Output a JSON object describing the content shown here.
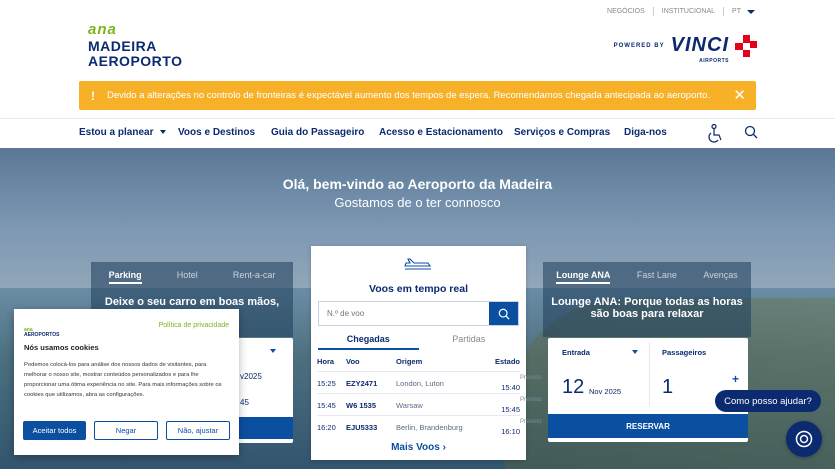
{
  "logo": {
    "ana": "ana",
    "line1": "MADEIRA",
    "line2": "AEROPORTO"
  },
  "toplinks": {
    "negocios": "NEGÓCIOS",
    "institucional": "INSTITUCIONAL",
    "lang": "PT"
  },
  "vinci": {
    "powered": "POWERED BY",
    "name": "VINCI",
    "airports": "AIRPORTS"
  },
  "alert": {
    "icon": "!",
    "text": "Devido a alterações no controlo de fronteiras é expectável aumento dos tempos de espera. Recomendamos chegada antecipada ao aeroporto.",
    "close": "✕"
  },
  "nav": {
    "items": [
      "Estou a planear",
      "Voos e Destinos",
      "Guia do Passageiro",
      "Acesso e Estacionamento",
      "Serviços e Compras",
      "Diga-nos"
    ]
  },
  "welcome": {
    "title": "Olá, bem-vindo ao Aeroporto da Madeira",
    "subtitle": "Gostamos de o ter connosco"
  },
  "parking": {
    "tabs": [
      "Parking",
      "Hotel",
      "Rent-a-car"
    ],
    "message": "Deixe o seu carro em boas mãos,",
    "date1": "v2025",
    "date2": "45"
  },
  "flights": {
    "title": "Voos em tempo real",
    "placeholder": "N.º de voo",
    "tabs": [
      "Chegadas",
      "Partidas"
    ],
    "headers": [
      "Hora",
      "Voo",
      "Origem",
      "Estado"
    ],
    "rows": [
      {
        "time": "15:25",
        "flight": "EZY2471",
        "origin": "London, Luton",
        "status": "Previsto",
        "eta": "15:40"
      },
      {
        "time": "15:45",
        "flight": "W6 1535",
        "origin": "Warsaw",
        "status": "Previsto",
        "eta": "15:45"
      },
      {
        "time": "16:20",
        "flight": "EJU5333",
        "origin": "Berlin, Brandenburg",
        "status": "Previsto",
        "eta": "16:10"
      }
    ],
    "more": "Mais Voos ›"
  },
  "lounge": {
    "tabs": [
      "Lounge ANA",
      "Fast Lane",
      "Avenças"
    ],
    "message1": "Lounge ANA: Porque todas as horas",
    "message2": "são boas para relaxar",
    "entry_label": "Entrada",
    "pax_label": "Passageiros",
    "day": "12",
    "month": "Nov 2025",
    "pax": "1",
    "plus": "+",
    "reserve": "RESERVAR"
  },
  "help": {
    "label": "Como posso ajudar?"
  },
  "cookie": {
    "brand1": "ana",
    "brand2": "AEROPORTOS",
    "policy": "Política de privacidade",
    "heading": "Nós usamos cookies",
    "text": "Podemos colocá-los para análise dos nossos dados de visitantes, para melhorar o nosso site, mostrar conteúdos personalizados e para lhe proporcionar uma ótima experiência no site. Para mais informações sobre os cookies que utilizamos, abra as configurações.",
    "accept": "Aceitar todos",
    "deny": "Negar",
    "adjust": "Não, ajustar"
  },
  "colors": {
    "brand": "#0b2a6f",
    "accent": "#0b4fa0",
    "alert": "#f7b128",
    "ana_green": "#7ab51d",
    "vinci_red": "#e2001a"
  }
}
